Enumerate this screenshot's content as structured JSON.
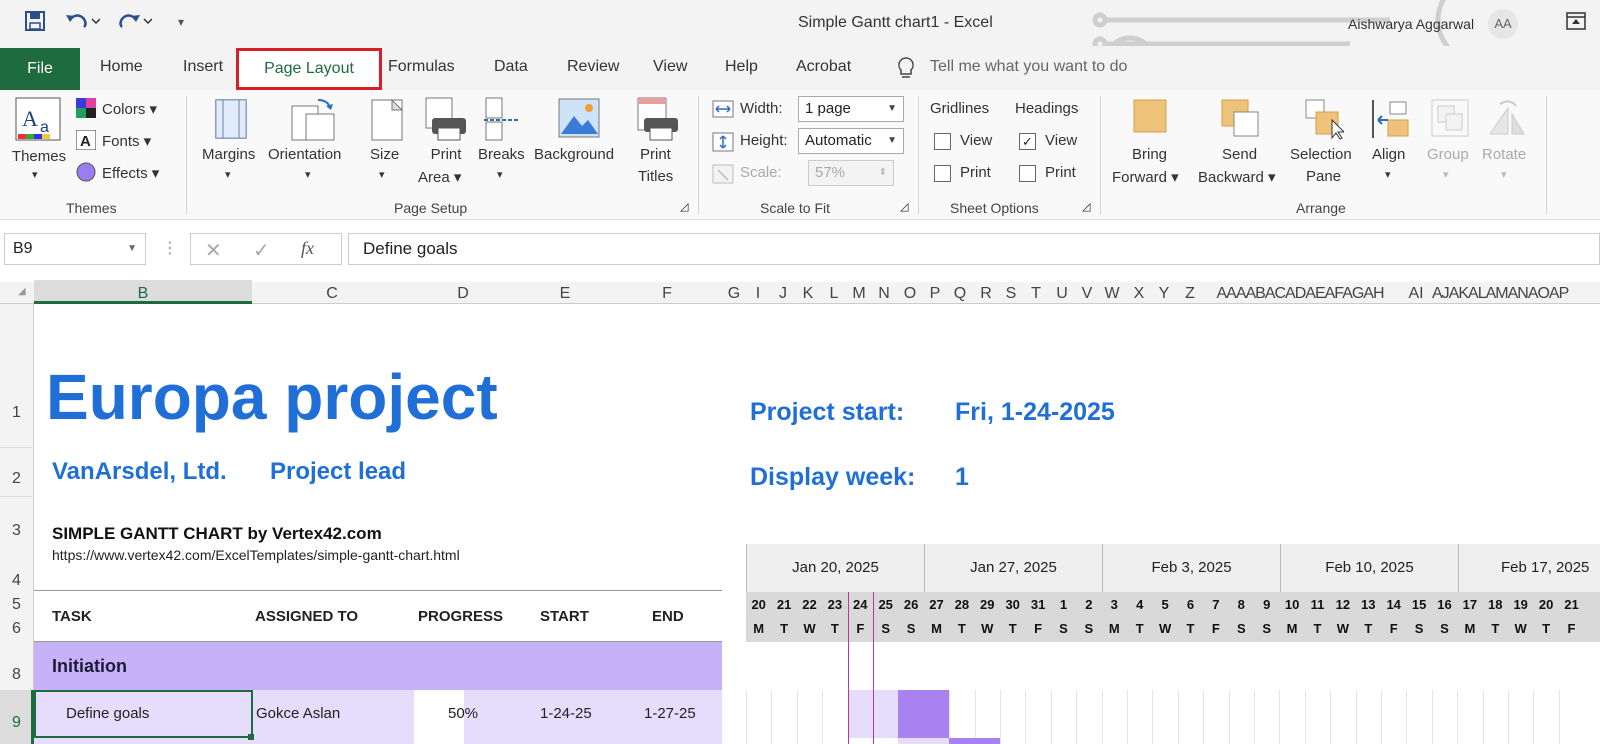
{
  "window": {
    "title": "Simple Gantt chart1  -  Excel",
    "user": "Aishwarya Aggarwal",
    "initials": "AA"
  },
  "tabs": [
    "File",
    "Home",
    "Insert",
    "Page Layout",
    "Formulas",
    "Data",
    "Review",
    "View",
    "Help",
    "Acrobat"
  ],
  "tell_me": "Tell me what you want to do",
  "ribbon": {
    "themes": {
      "themes": "Themes",
      "colors": "Colors",
      "fonts": "Fonts",
      "effects": "Effects",
      "group": "Themes"
    },
    "page_setup": {
      "margins": "Margins",
      "orientation": "Orientation",
      "size": "Size",
      "print_area_1": "Print",
      "print_area_2": "Area",
      "breaks": "Breaks",
      "background": "Background",
      "print_titles_1": "Print",
      "print_titles_2": "Titles",
      "group": "Page Setup"
    },
    "scale": {
      "width_label": "Width:",
      "width_value": "1 page",
      "height_label": "Height:",
      "height_value": "Automatic",
      "scale_label": "Scale:",
      "scale_value": "57%",
      "group": "Scale to Fit"
    },
    "sheet_options": {
      "gridlines": "Gridlines",
      "headings": "Headings",
      "view": "View",
      "print": "Print",
      "group": "Sheet Options"
    },
    "arrange": {
      "bring_1": "Bring",
      "bring_2": "Forward",
      "send_1": "Send",
      "send_2": "Backward",
      "sel_1": "Selection",
      "sel_2": "Pane",
      "align": "Align",
      "group_btn": "Group",
      "rotate": "Rotate",
      "group": "Arrange"
    }
  },
  "formula_bar": {
    "name_box": "B9",
    "fx": "fx",
    "content": "Define goals"
  },
  "columns": [
    "B",
    "C",
    "D",
    "E",
    "F",
    "G",
    "I",
    "J",
    "K",
    "L",
    "M",
    "N",
    "O",
    "P",
    "Q",
    "R",
    "S",
    "T",
    "U",
    "V",
    "W",
    "X",
    "Y",
    "Z",
    "AAAABACADAEAFAGAH",
    "AI",
    "AJAKALAMANAOAP"
  ],
  "rows": [
    "1",
    "2",
    "3",
    "4",
    "5",
    "6",
    "8",
    "9"
  ],
  "sheet": {
    "title": "Europa project",
    "company": "VanArsdel, Ltd.",
    "lead": "Project lead",
    "subtitle": "SIMPLE GANTT CHART by Vertex42.com",
    "url": "https://www.vertex42.com/ExcelTemplates/simple-gantt-chart.html",
    "project_start_label": "Project start:",
    "project_start_value": "Fri, 1-24-2025",
    "display_week_label": "Display week:",
    "display_week_value": "1",
    "headers": [
      "TASK",
      "ASSIGNED TO",
      "PROGRESS",
      "START",
      "END"
    ],
    "phase": "Initiation",
    "task": {
      "name": "Define goals",
      "assigned": "Gokce Aslan",
      "progress": "50%",
      "start": "1-24-25",
      "end": "1-27-25"
    }
  },
  "gantt": {
    "weeks": [
      "Jan 20, 2025",
      "Jan 27, 2025",
      "Feb 3, 2025",
      "Feb 10, 2025",
      "Feb 17, 2025"
    ],
    "dates": [
      "20",
      "21",
      "22",
      "23",
      "24",
      "25",
      "26",
      "27",
      "28",
      "29",
      "30",
      "31",
      "1",
      "2",
      "3",
      "4",
      "5",
      "6",
      "7",
      "8",
      "9",
      "10",
      "11",
      "12",
      "13",
      "14",
      "15",
      "16",
      "17",
      "18",
      "19",
      "20",
      "21"
    ],
    "weekdays": [
      "M",
      "T",
      "W",
      "T",
      "F",
      "S",
      "S",
      "M",
      "T",
      "W",
      "T",
      "F",
      "S",
      "S",
      "M",
      "T",
      "W",
      "T",
      "F",
      "S",
      "S",
      "M",
      "T",
      "W",
      "T",
      "F",
      "S",
      "S",
      "M",
      "T",
      "W",
      "T",
      "F"
    ]
  },
  "colors": {
    "accent": "#1f6fd6",
    "excel_green": "#1e6b40",
    "phase": "#c7b2f8",
    "task_row": "#e6dcfb",
    "bar": "#a982f2",
    "highlight": "#d61f26"
  }
}
